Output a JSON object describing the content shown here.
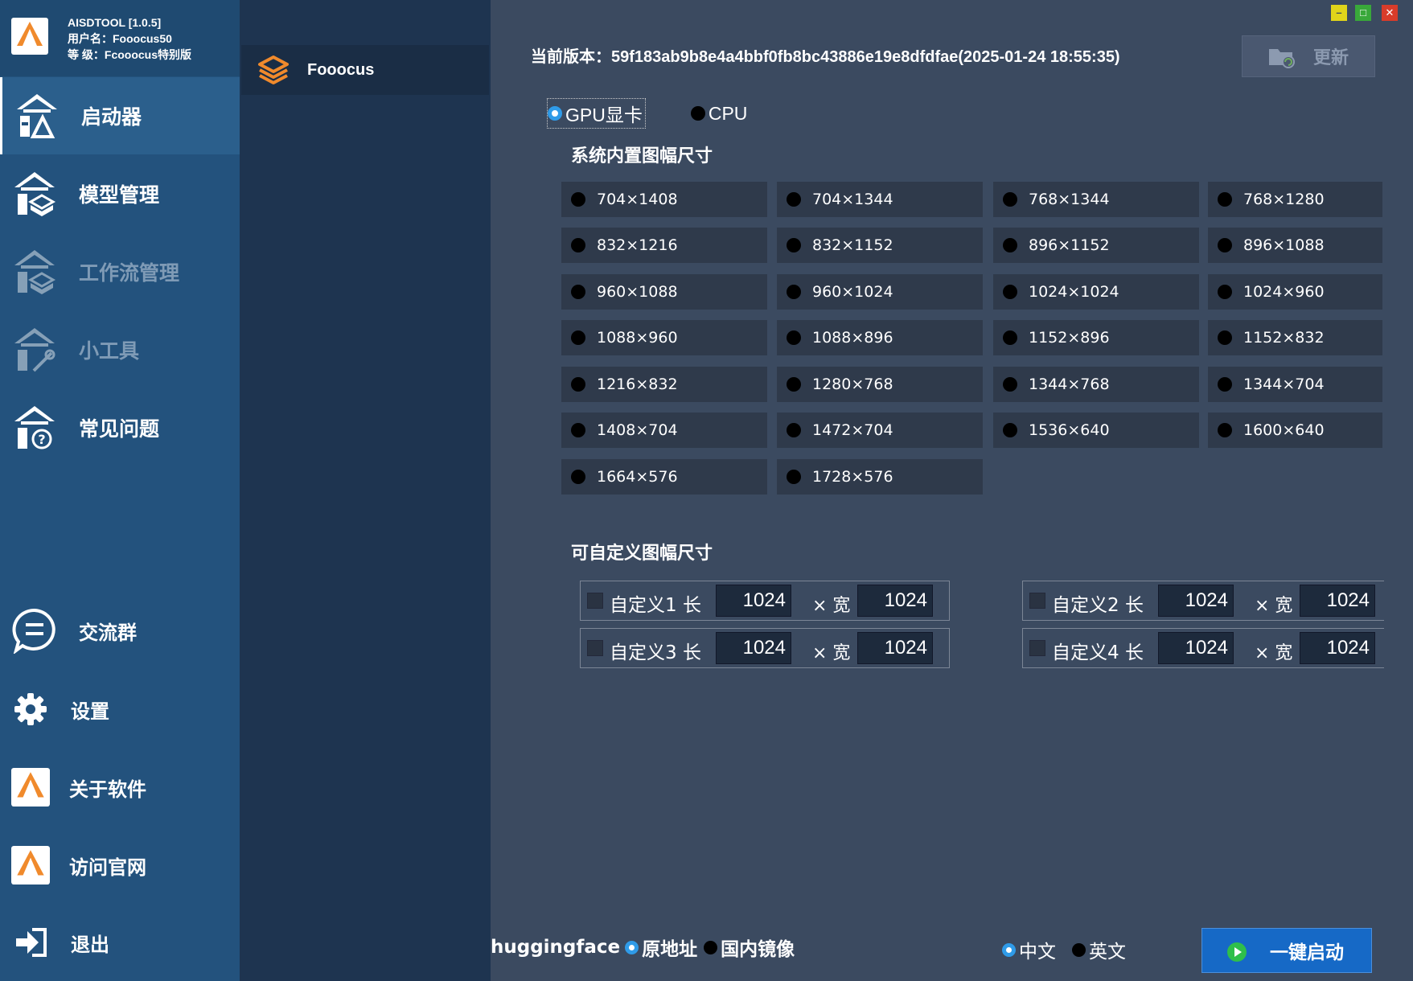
{
  "brand": {
    "title": "AISDTOOL [1.0.5]",
    "username": "用户名：Fooocus50",
    "level": "等    级：Fcooocus特别版",
    "logo_text": "AISDTOOL"
  },
  "sidebar": {
    "items": [
      {
        "label": "启动器",
        "icon": "launcher-icon"
      },
      {
        "label": "模型管理",
        "icon": "model-manage-icon"
      },
      {
        "label": "工作流管理",
        "icon": "workflow-manage-icon"
      },
      {
        "label": "小工具",
        "icon": "tools-icon"
      },
      {
        "label": "常见问题",
        "icon": "faq-icon"
      }
    ],
    "bottom": [
      {
        "label": "交流群",
        "icon": "chat-icon"
      },
      {
        "label": "设置",
        "icon": "gear-icon"
      },
      {
        "label": "关于软件",
        "icon": "app-logo-icon"
      },
      {
        "label": "访问官网",
        "icon": "app-logo-icon"
      },
      {
        "label": "退出",
        "icon": "exit-icon"
      }
    ]
  },
  "middle": {
    "selected": "Fooocus"
  },
  "window": {
    "minimize": "–",
    "maximize": "□",
    "close": "✕"
  },
  "main": {
    "version": "当前版本：59f183ab9b8e4a4bbf0fb8bc43886e19e8dfdfae(2025-01-24 18:55:35)",
    "update_label": "更新",
    "processor": {
      "gpu": "GPU显卡",
      "cpu": "CPU",
      "selected": "GPU显卡"
    },
    "builtin_title": "系统内置图幅尺寸",
    "sizes": [
      "704×1408",
      "704×1344",
      "768×1344",
      "768×1280",
      "832×1216",
      "832×1152",
      "896×1152",
      "896×1088",
      "960×1088",
      "960×1024",
      "1024×1024",
      "1024×960",
      "1088×960",
      "1088×896",
      "1152×896",
      "1152×832",
      "1216×832",
      "1280×768",
      "1344×768",
      "1344×704",
      "1408×704",
      "1472×704",
      "1536×640",
      "1600×640",
      "1664×576",
      "1728×576"
    ],
    "custom_title": "可自定义图幅尺寸",
    "custom": [
      {
        "name": "自定义1 长",
        "length": "1024",
        "x_label": "× 宽",
        "width": "1024"
      },
      {
        "name": "自定义2 长",
        "length": "1024",
        "x_label": "× 宽",
        "width": "1024"
      },
      {
        "name": "自定义3 长",
        "length": "1024",
        "x_label": "× 宽",
        "width": "1024"
      },
      {
        "name": "自定义4 长",
        "length": "1024",
        "x_label": "× 宽",
        "width": "1024"
      }
    ],
    "huggingface": {
      "label": "huggingface",
      "original": "原地址",
      "mirror": "国内镜像",
      "selected": "原地址"
    },
    "language": {
      "zh": "中文",
      "en": "英文",
      "selected": "中文"
    },
    "launch_label": "一键启动"
  },
  "colors": {
    "sidebar": "#23527d",
    "middle_panel": "#1e3450",
    "main": "#3b4a60",
    "accent_orange": "#f08a2c",
    "radio_selected": "#2f9be8",
    "launch_button": "#1669c6"
  }
}
